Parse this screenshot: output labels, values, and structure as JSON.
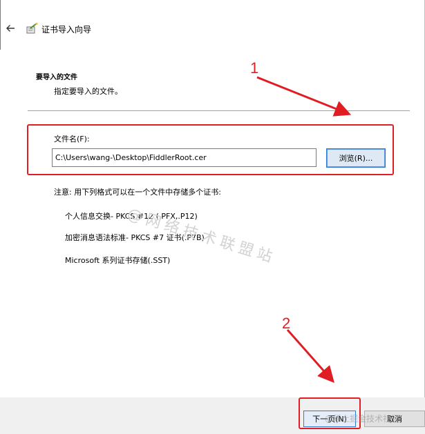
{
  "window": {
    "title": "证书导入向导",
    "back_icon": "back-arrow-icon",
    "wizard_icon": "certificate-wizard-icon"
  },
  "section": {
    "heading": "要导入的文件",
    "description": "指定要导入的文件。"
  },
  "file": {
    "label": "文件名(F):",
    "value": "C:\\Users\\wang-\\Desktop\\FiddlerRoot.cer",
    "browse_label": "浏览(R)..."
  },
  "note": "注意: 用下列格式可以在一个文件中存储多个证书:",
  "formats": [
    "个人信息交换- PKCS #12 (.PFX,.P12)",
    "加密消息语法标准- PKCS #7 证书(.P7B)",
    "Microsoft 系列证书存储(.SST)"
  ],
  "watermark": "@网络技术联盟站",
  "source_watermark": "@稀土掘金技术社区",
  "annotations": {
    "step1": "1",
    "step2": "2",
    "color": "#e11d24"
  },
  "footer": {
    "next_label": "下一页(N)",
    "cancel_label": "取消"
  }
}
